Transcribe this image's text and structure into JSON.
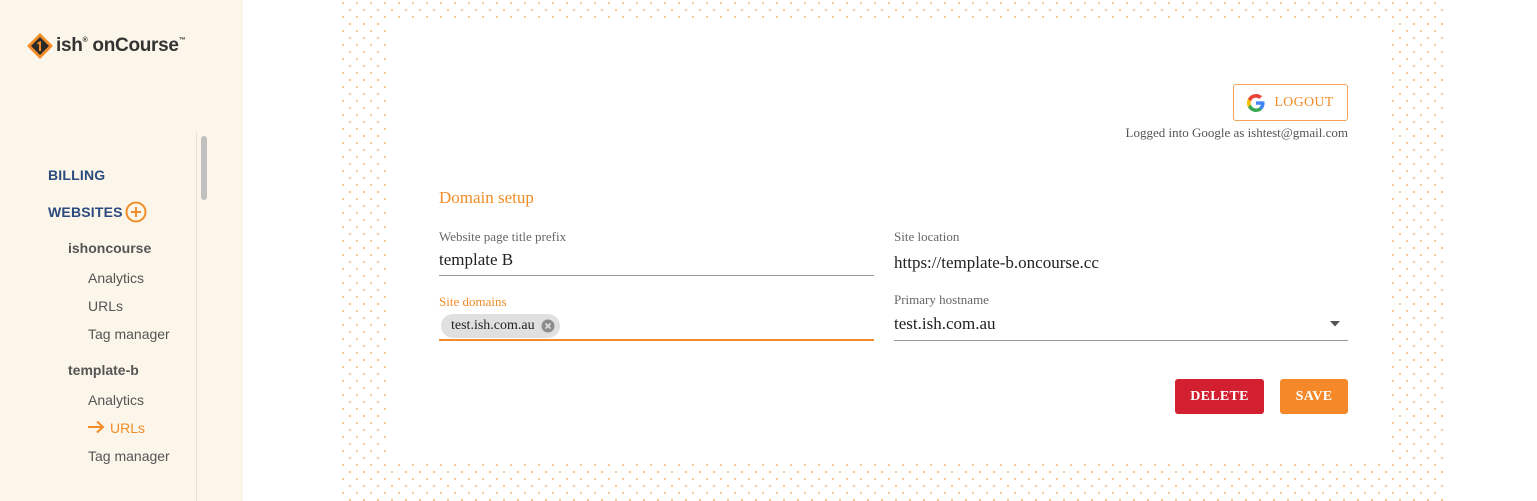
{
  "brand": {
    "logo_text": "ish",
    "logo_text_2": "onCourse",
    "accent": "#f28c28",
    "nav_color": "#2b4a7e"
  },
  "sidebar": {
    "billing_label": "BILLING",
    "websites_label": "WEBSITES",
    "sites": [
      {
        "name": "ishoncourse",
        "items": [
          "Analytics",
          "URLs",
          "Tag manager"
        ]
      },
      {
        "name": "template-b",
        "items": [
          "Analytics",
          "URLs",
          "Tag manager"
        ],
        "active": "URLs"
      }
    ]
  },
  "auth": {
    "logout_label": "LOGOUT",
    "logged_in_text": "Logged into Google as ishtest@gmail.com"
  },
  "domain_setup": {
    "title": "Domain setup",
    "page_title_prefix_label": "Website page title prefix",
    "page_title_prefix_value": "template B",
    "site_location_label": "Site location",
    "site_location_value": "https://template-b.oncourse.cc",
    "site_domains_label": "Site domains",
    "site_domains": [
      "test.ish.com.au"
    ],
    "primary_hostname_label": "Primary hostname",
    "primary_hostname_value": "test.ish.com.au"
  },
  "actions": {
    "delete_label": "DELETE",
    "save_label": "SAVE"
  }
}
